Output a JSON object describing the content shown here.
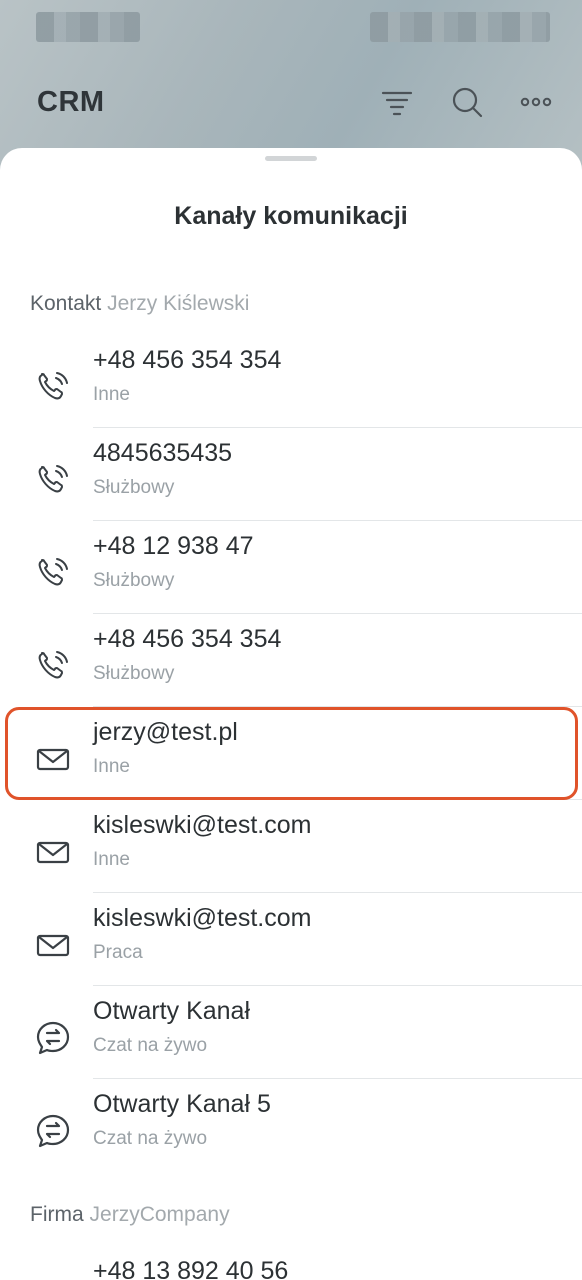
{
  "app": {
    "title": "CRM",
    "icons": [
      "funnel-icon",
      "search-icon",
      "more-icon"
    ]
  },
  "sheet": {
    "title": "Kanały komunikacji"
  },
  "contact_section": {
    "label": "Kontakt",
    "name": "Jerzy Kiślewski",
    "items": [
      {
        "value": "+48 456 354 354",
        "type": "Inne",
        "icon": "phone-icon"
      },
      {
        "value": "4845635435",
        "type": "Służbowy",
        "icon": "phone-icon"
      },
      {
        "value": "+48 12 938 47",
        "type": "Służbowy",
        "icon": "phone-icon"
      },
      {
        "value": "+48 456 354 354",
        "type": "Służbowy",
        "icon": "phone-icon"
      },
      {
        "value": "jerzy@test.pl",
        "type": "Inne",
        "icon": "mail-icon",
        "highlighted": true
      },
      {
        "value": "kisleswki@test.com",
        "type": "Inne",
        "icon": "mail-icon"
      },
      {
        "value": "kisleswki@test.com",
        "type": "Praca",
        "icon": "mail-icon"
      },
      {
        "value": "Otwarty Kanał",
        "type": "Czat na żywo",
        "icon": "chat-icon"
      },
      {
        "value": "Otwarty Kanał 5",
        "type": "Czat na żywo",
        "icon": "chat-icon"
      }
    ]
  },
  "company_section": {
    "label": "Firma",
    "name": "JerzyCompany",
    "items": [
      {
        "value": "+48 13 892 40 56",
        "icon": "phone-icon"
      }
    ]
  },
  "colors": {
    "highlight": "#e0532a",
    "primary_text": "#2c3134",
    "secondary_text": "#9aa1a6"
  }
}
